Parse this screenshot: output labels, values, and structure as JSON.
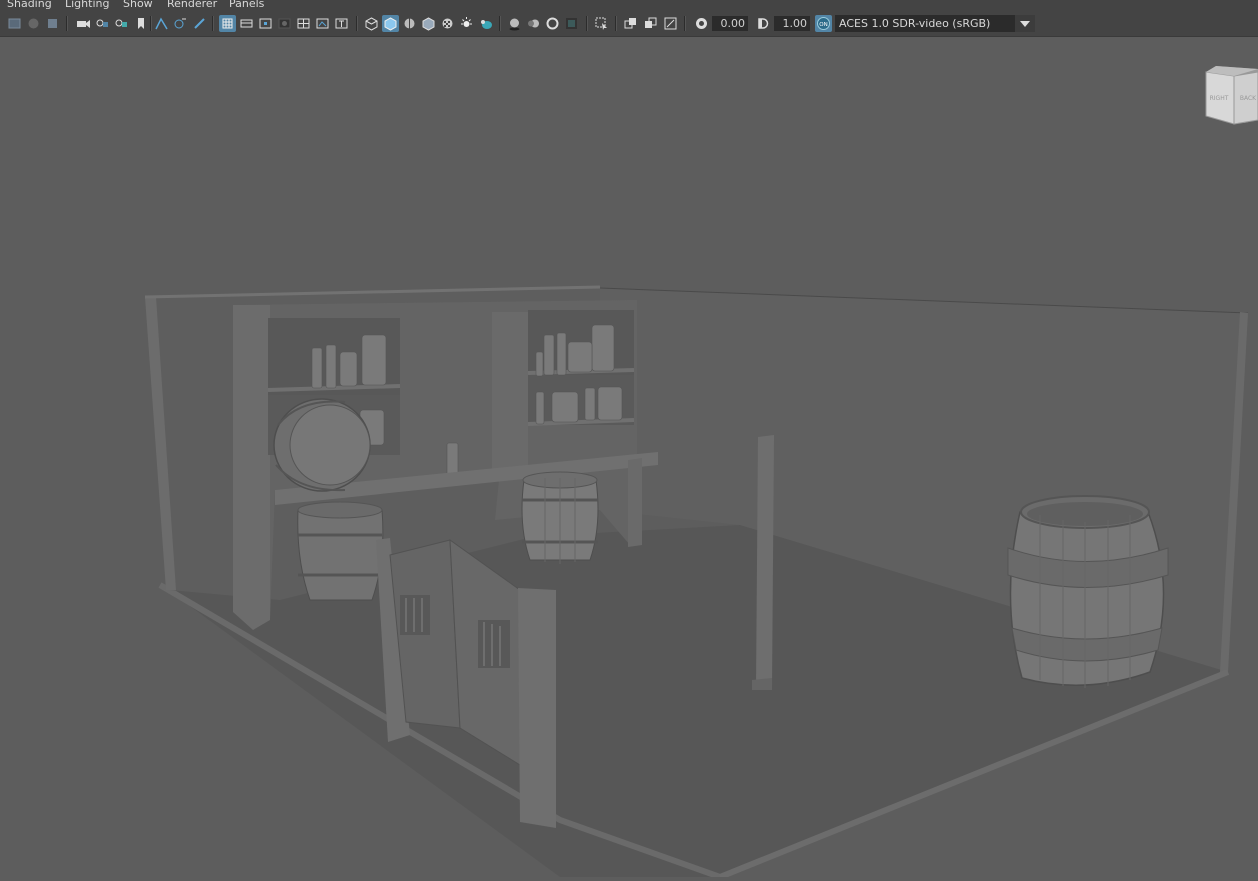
{
  "menu": {
    "items": [
      {
        "label": "Shading"
      },
      {
        "label": "Lighting"
      },
      {
        "label": "Show"
      },
      {
        "label": "Renderer"
      },
      {
        "label": "Panels"
      }
    ]
  },
  "toolbar": {
    "exposure_value": "0.00",
    "gamma_value": "1.00",
    "color_management_badge": "ON",
    "color_space": "ACES 1.0 SDR-video (sRGB)",
    "icons": [
      "select-camera-icon",
      "camera-attributes-icon",
      "bookmarks-icon",
      "image-plane-icon",
      "camera-icon",
      "film-gate-icon",
      "resolution-gate-icon",
      "gate-mask-icon",
      "field-chart-icon",
      "safe-action-icon",
      "safe-title-icon",
      "wireframe-icon",
      "smooth-shade-icon",
      "wireframe-on-shaded-icon",
      "textured-icon",
      "default-lighting-icon",
      "shadows-icon",
      "screen-space-ao-icon",
      "motion-blur-icon",
      "anti-aliasing-icon",
      "depth-of-field-icon",
      "isolate-select-icon",
      "xray-icon",
      "xray-joints-icon",
      "xray-components-icon",
      "exposure-icon",
      "gamma-icon",
      "color-management-icon"
    ]
  },
  "viewcube": {
    "face_right": "RIGHT",
    "face_back": "BACK"
  },
  "colors": {
    "ui_bg": "#444444",
    "viewport_bg": "#5d5d5d",
    "accent": "#5285a6"
  }
}
